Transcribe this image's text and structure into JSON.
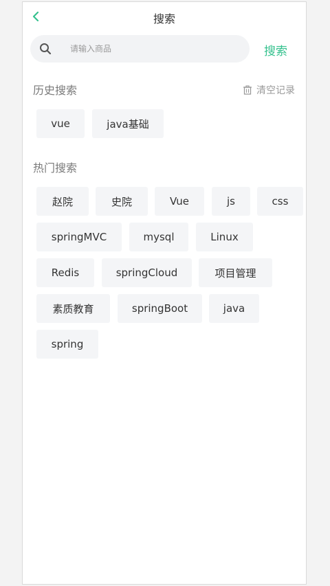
{
  "header": {
    "title": "搜索",
    "back_icon": "chevron-left-icon",
    "accent_color": "#35c18e"
  },
  "search": {
    "placeholder": "请输入商品",
    "value": "",
    "button_label": "搜索",
    "icon": "search-icon"
  },
  "history": {
    "title": "历史搜索",
    "clear_label": "清空记录",
    "clear_icon": "trash-icon",
    "items": [
      {
        "label": "vue"
      },
      {
        "label": "java基础"
      }
    ]
  },
  "hot": {
    "title": "热门搜索",
    "items": [
      {
        "label": "赵院"
      },
      {
        "label": "史院"
      },
      {
        "label": "Vue"
      },
      {
        "label": "js"
      },
      {
        "label": "css"
      },
      {
        "label": "springMVC"
      },
      {
        "label": "mysql"
      },
      {
        "label": "Linux"
      },
      {
        "label": "Redis"
      },
      {
        "label": "springCloud"
      },
      {
        "label": "项目管理"
      },
      {
        "label": "素质教育"
      },
      {
        "label": "springBoot"
      },
      {
        "label": "java"
      },
      {
        "label": "spring"
      }
    ]
  }
}
